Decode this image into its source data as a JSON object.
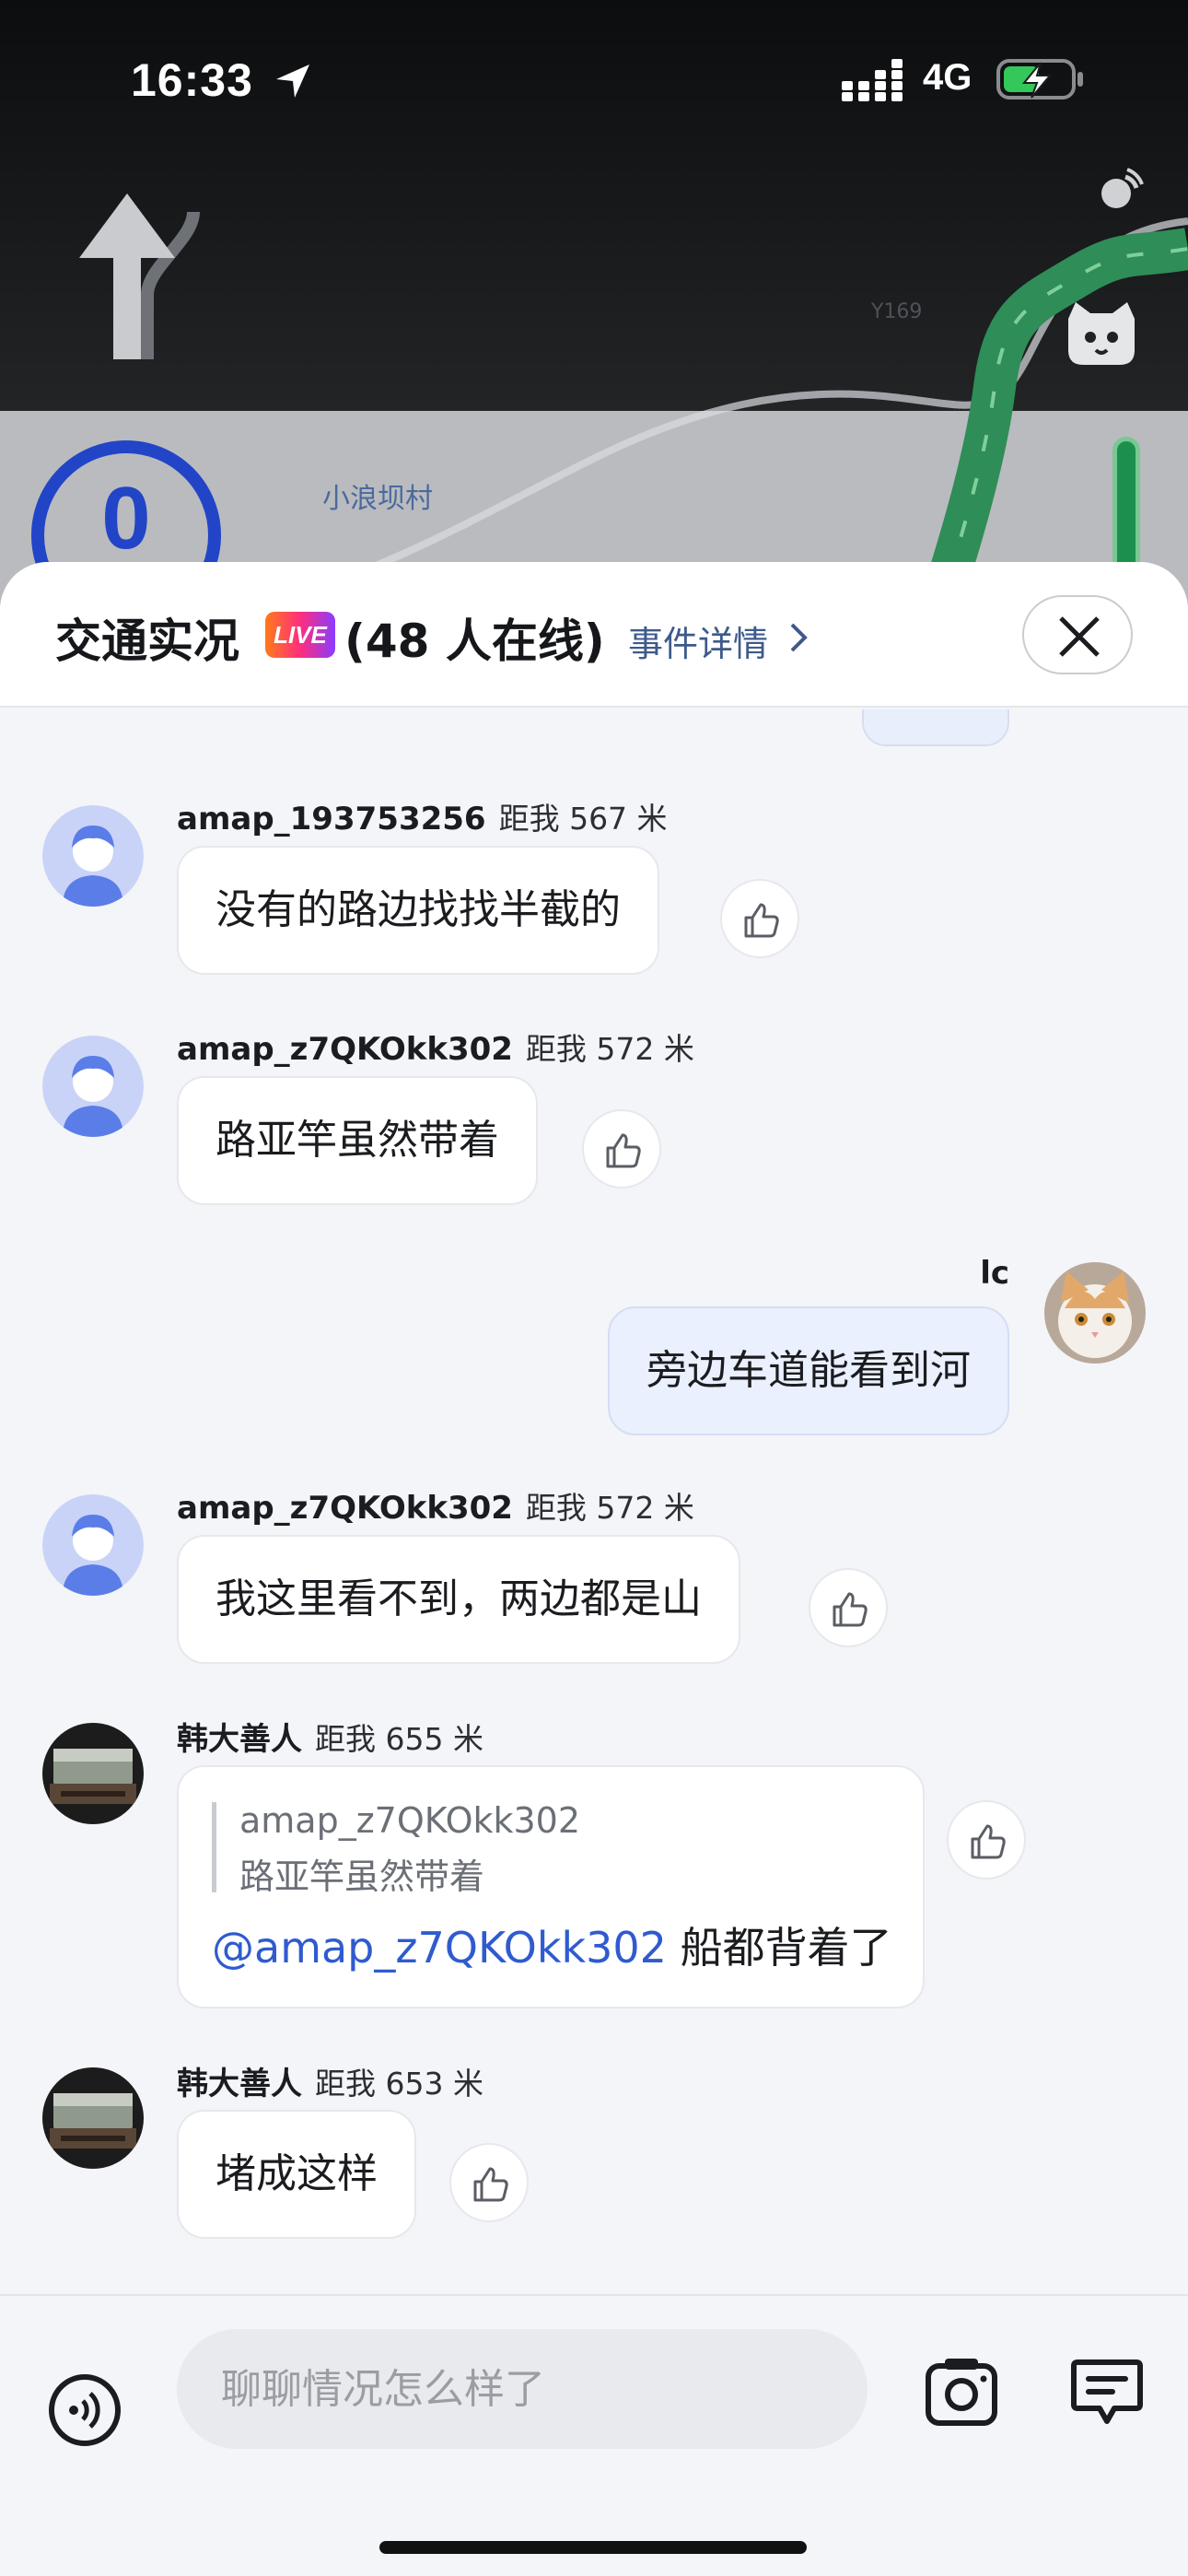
{
  "status_bar": {
    "time": "16:33",
    "network": "4G"
  },
  "map": {
    "place_label": "小浪坝村",
    "road_code": "Y169",
    "speed_value": "0"
  },
  "header": {
    "title": "交通实况",
    "live_badge": "LIVE",
    "online_count": "(48 人在线)",
    "event_link": "事件详情"
  },
  "messages": [
    {
      "user": "amap_193753256",
      "distance": "距我 567 米",
      "text": "没有的路边找找半截的",
      "avatar": "default-avatar"
    },
    {
      "user": "amap_z7QKOkk302",
      "distance": "距我 572 米",
      "text": "路亚竿虽然带着",
      "avatar": "default-avatar"
    },
    {
      "user": "lc",
      "text": "旁边车道能看到河",
      "mine": true,
      "avatar": "cat-avatar"
    },
    {
      "user": "amap_z7QKOkk302",
      "distance": "距我 572 米",
      "text": "我这里看不到，两边都是山",
      "avatar": "default-avatar"
    },
    {
      "user": "韩大善人",
      "distance": "距我 655 米",
      "avatar": "photo-avatar",
      "quote": {
        "user": "amap_z7QKOkk302",
        "text": "路亚竿虽然带着"
      },
      "mention": "@amap_z7QKOkk302",
      "text": " 船都背着了"
    },
    {
      "user": "韩大善人",
      "distance": "距我 653 米",
      "text": "堵成这样",
      "avatar": "photo-avatar"
    }
  ],
  "input": {
    "placeholder": "聊聊情况怎么样了"
  },
  "colors": {
    "accent": "#2f5bcf",
    "speed_ring": "#2244c7",
    "my_bubble": "#eaf0fd"
  }
}
